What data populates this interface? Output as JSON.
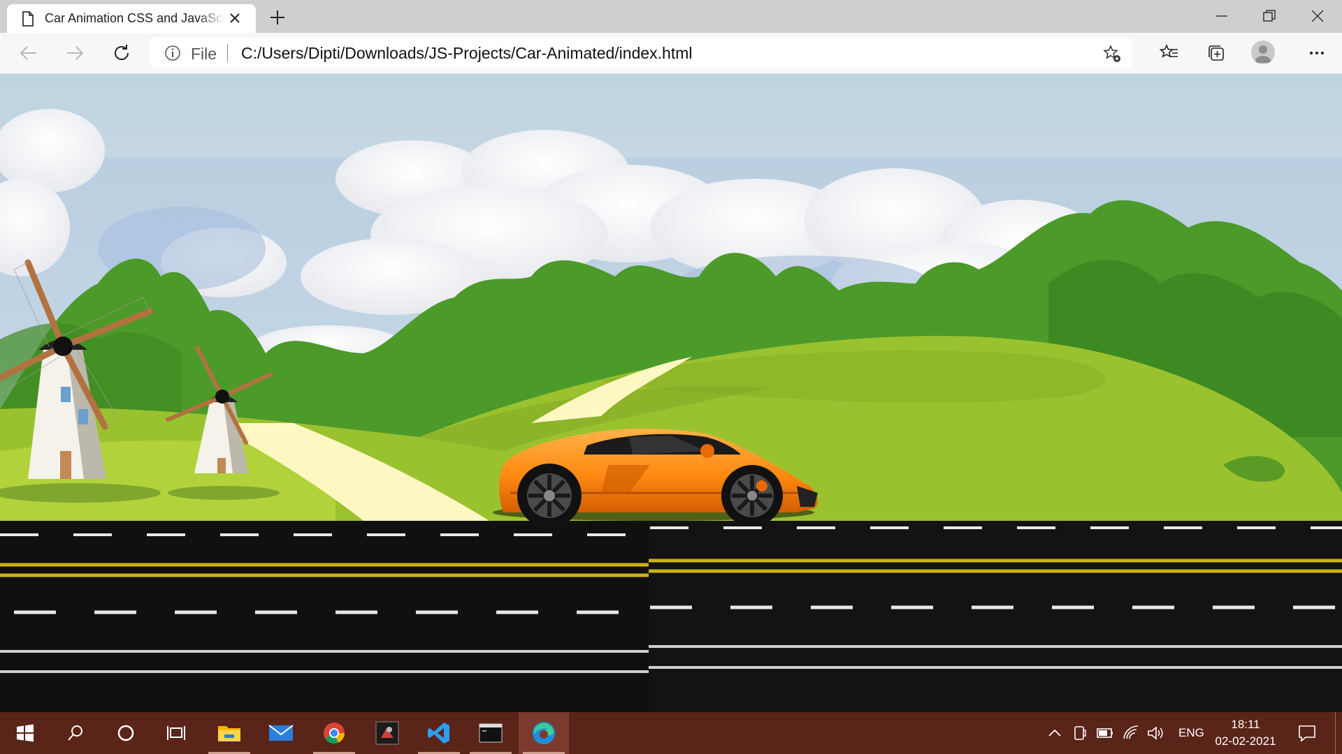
{
  "browser": {
    "tab_title": "Car Animation CSS and JavaScript",
    "address": {
      "scheme_label": "File",
      "url": "C:/Users/Dipti/Downloads/JS-Projects/Car-Animated/index.html"
    }
  },
  "icons": {
    "tab": [
      "page-icon",
      "close-icon",
      "plus-icon"
    ],
    "window": [
      "minimize-icon",
      "restore-icon",
      "close-icon"
    ],
    "toolbar": [
      "back-icon",
      "forward-icon",
      "refresh-icon",
      "info-icon",
      "add-favorite-icon",
      "favorites-icon",
      "collections-icon",
      "profile-icon",
      "more-icon"
    ],
    "taskbar": [
      "windows-icon",
      "search-icon",
      "cortana-icon",
      "task-view-icon",
      "file-explorer-icon",
      "mail-icon",
      "chrome-icon",
      "app-icon",
      "vscode-icon",
      "terminal-icon",
      "edge-icon"
    ],
    "tray": [
      "chevron-up-icon",
      "device-icon",
      "battery-icon",
      "wifi-icon",
      "volume-icon",
      "notifications-icon"
    ]
  },
  "taskbar": {
    "language": "ENG",
    "time": "18:11",
    "date": "02-02-2021"
  },
  "colors": {
    "taskbar": "#5a2419",
    "sky": "#c7dbe6",
    "grass": "#9ac22e",
    "trees": "#4c9a2a",
    "road": "#131313",
    "car": "#ff8a12"
  }
}
